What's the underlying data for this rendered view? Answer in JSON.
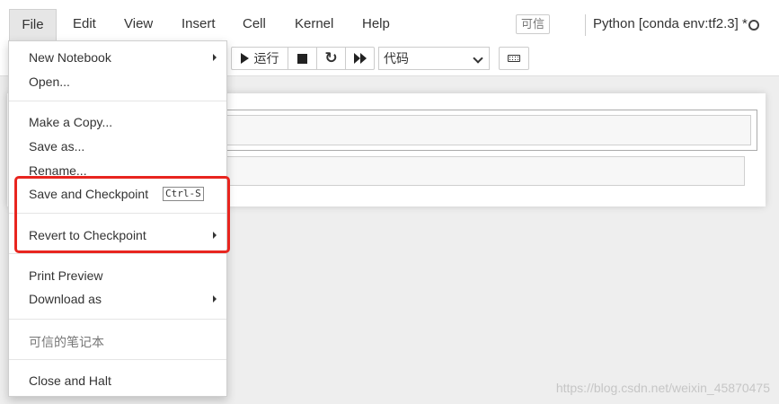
{
  "menubar": {
    "items": [
      "File",
      "Edit",
      "View",
      "Insert",
      "Cell",
      "Kernel",
      "Help"
    ],
    "trusted_label": "可信",
    "kernel_name": "Python [conda env:tf2.3] *"
  },
  "toolbar": {
    "run_label": "运行",
    "celltype_value": "代码"
  },
  "file_menu": {
    "new_notebook": "New Notebook",
    "open": "Open...",
    "make_copy": "Make a Copy...",
    "save_as": "Save as...",
    "rename": "Rename...",
    "save_checkpoint": "Save and Checkpoint",
    "save_checkpoint_shortcut": "Ctrl-S",
    "revert_checkpoint": "Revert to Checkpoint",
    "print_preview": "Print Preview",
    "download_as": "Download as",
    "trusted_notebook": "可信的笔记本",
    "close_halt": "Close and Halt"
  },
  "highlight_color": "#e8251f",
  "watermark": "https://blog.csdn.net/weixin_45870475"
}
